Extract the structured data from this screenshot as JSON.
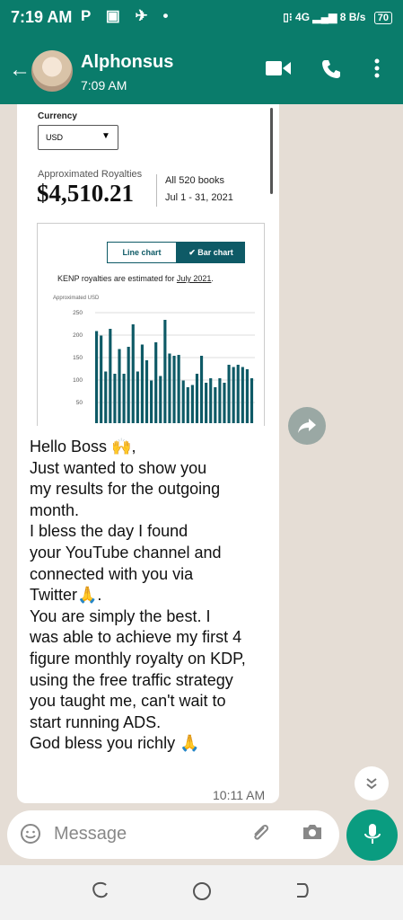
{
  "status_bar": {
    "time": "7:19 AM",
    "icons": "P ▣ ✈ •",
    "network": "4G",
    "speed": "8 B/s",
    "battery": "70"
  },
  "header": {
    "contact_name": "Alphonsus",
    "last_seen": "7:09 AM"
  },
  "screenshot": {
    "currency_label": "Currency",
    "currency_value": "USD",
    "royalties_label": "Approximated Royalties",
    "royalties_amount": "$4,510.21",
    "books": "All 520 books",
    "date_range": "Jul 1 - 31, 2021",
    "line_chart_label": "Line chart",
    "bar_chart_label": "Bar chart",
    "kenp_text": "KENP royalties are estimated for ",
    "kenp_link": "July 2021",
    "approx_usd_label": "Approximated USD"
  },
  "chart_data": {
    "type": "bar",
    "ylabel": "Approximated USD",
    "yticks": [
      250,
      200,
      150,
      100,
      50
    ],
    "values": [
      205,
      195,
      115,
      210,
      110,
      165,
      110,
      170,
      220,
      115,
      175,
      140,
      95,
      180,
      105,
      230,
      155,
      150,
      152,
      95,
      80,
      85,
      110,
      150,
      90,
      100,
      80,
      100,
      90,
      130,
      125,
      130,
      125,
      120,
      100
    ]
  },
  "message": {
    "text": "Hello Boss 🙌,\nJust wanted to show you\nmy results for the outgoing\nmonth.\nI bless the day I found\nyour YouTube channel and\nconnected with you via\nTwitter🙏.\nYou are simply the best. I\nwas able to achieve my first 4\nfigure monthly royalty on KDP,\nusing the free traffic strategy\nyou taught me, can't wait to\nstart running ADS.\nGod bless you richly 🙏",
    "time": "10:11 AM"
  },
  "input": {
    "placeholder": "Message"
  },
  "colors": {
    "header_green": "#0a7c6b",
    "chart_teal": "#0e5a66",
    "mic_green": "#0a9c80"
  },
  "icons": [
    "back-arrow-icon",
    "video-call-icon",
    "phone-icon",
    "more-icon",
    "forward-icon",
    "scroll-down-icon",
    "emoji-icon",
    "attach-icon",
    "camera-icon",
    "mic-icon"
  ]
}
